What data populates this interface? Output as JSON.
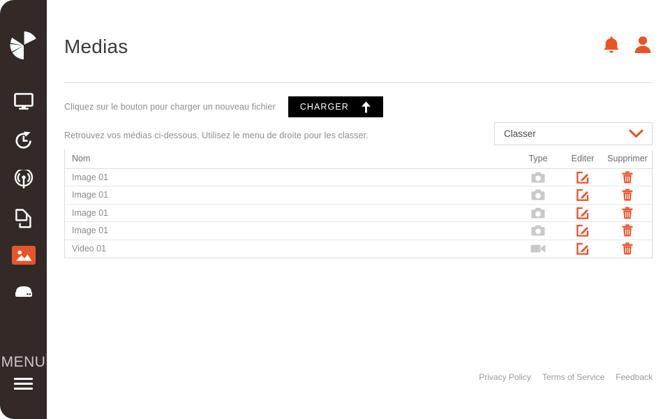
{
  "colors": {
    "sidebar_bg": "#332a28",
    "accent": "#e8542a",
    "button_bg": "#000000",
    "text_muted": "#8e8e8e",
    "border": "#dedede"
  },
  "sidebar": {
    "logo": "pie-chart-logo",
    "items": [
      {
        "icon": "monitor-icon",
        "name": "display",
        "active": false
      },
      {
        "icon": "refresh-icon",
        "name": "refresh",
        "active": false
      },
      {
        "icon": "broadcast-icon",
        "name": "broadcast",
        "active": false
      },
      {
        "icon": "copy-icon",
        "name": "documents",
        "active": false
      },
      {
        "icon": "image-icon",
        "name": "medias",
        "active": true
      },
      {
        "icon": "server-icon",
        "name": "storage",
        "active": false
      }
    ],
    "menu_label": "MENU",
    "menu_icon": "hamburger-icon"
  },
  "header": {
    "title": "Medias",
    "notification_icon": "bell-icon",
    "account_icon": "user-icon"
  },
  "upload": {
    "hint": "Cliquez sur le bouton pour charger un nouveau fichier",
    "button_label": "CHARGER",
    "button_icon": "arrow-up-icon"
  },
  "sort": {
    "hint": "Retrouvez vos médias ci-dessous. Utilisez le menu de droite pour les classer.",
    "select_value": "Classer",
    "select_icon": "chevron-down-icon"
  },
  "table": {
    "columns": [
      "Nom",
      "Type",
      "Editer",
      "Supprimer"
    ],
    "rows": [
      {
        "nom": "Image 01",
        "type_icon": "camera-icon",
        "edit_icon": "edit-icon",
        "delete_icon": "trash-icon"
      },
      {
        "nom": "Image 01",
        "type_icon": "camera-icon",
        "edit_icon": "edit-icon",
        "delete_icon": "trash-icon"
      },
      {
        "nom": "Image 01",
        "type_icon": "camera-icon",
        "edit_icon": "edit-icon",
        "delete_icon": "trash-icon"
      },
      {
        "nom": "Image 01",
        "type_icon": "camera-icon",
        "edit_icon": "edit-icon",
        "delete_icon": "trash-icon"
      },
      {
        "nom": "Video 01",
        "type_icon": "video-icon",
        "edit_icon": "edit-icon",
        "delete_icon": "trash-icon"
      }
    ]
  },
  "footer": {
    "links": [
      "Privacy Policy",
      "Terms of Service",
      "Feedback"
    ]
  }
}
